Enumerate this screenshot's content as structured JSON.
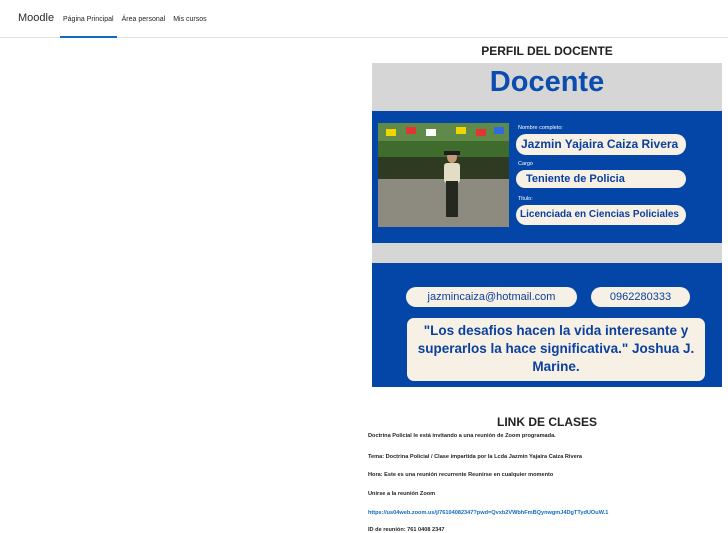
{
  "nav": {
    "brand": "Moodle",
    "items": [
      {
        "label": "Página Principal",
        "active": true
      },
      {
        "label": "Área personal",
        "active": false
      },
      {
        "label": "Mis cursos",
        "active": false
      }
    ]
  },
  "profile": {
    "title": "PERFIL DEL DOCENTE",
    "heading": "Docente",
    "name_label": "Nombre completo:",
    "name": "Jazmin Yajaira Caiza Rivera",
    "cargo_label": "Cargo",
    "cargo": "Teniente de Policia",
    "titulo_label": "Titulo:",
    "titulo": "Licenciada en Ciencias Policiales",
    "email": "jazmincaiza@hotmail.com",
    "phone": "0962280333",
    "quote": "\"Los desafios hacen la vida interesante y superarlos la hace significativa.\" Joshua J. Marine."
  },
  "classes": {
    "title": "LINK DE CLASES",
    "invite": "Doctrina Policial le está invitando a una reunión de Zoom programada.",
    "topic": "Tema: Doctrina Policial / Clase impartida por la Lcda Jazmin Yajaira Caiza Rivera",
    "time": "Hora: Este es una reunión recurrente Reunirse en cualquier momento",
    "join": "Unirse a la reunión Zoom",
    "url": "https://us04web.zoom.us/j/76104082347?pwd=Qvxb2VWbhFmBQynwgmJ4DgTTydUOuW.1",
    "meeting_id": "ID de reunión: 761 0408 2347"
  },
  "colors": {
    "card_blue": "#0445a8",
    "accent": "#0f6cbf",
    "pill": "#f6f1e4"
  }
}
